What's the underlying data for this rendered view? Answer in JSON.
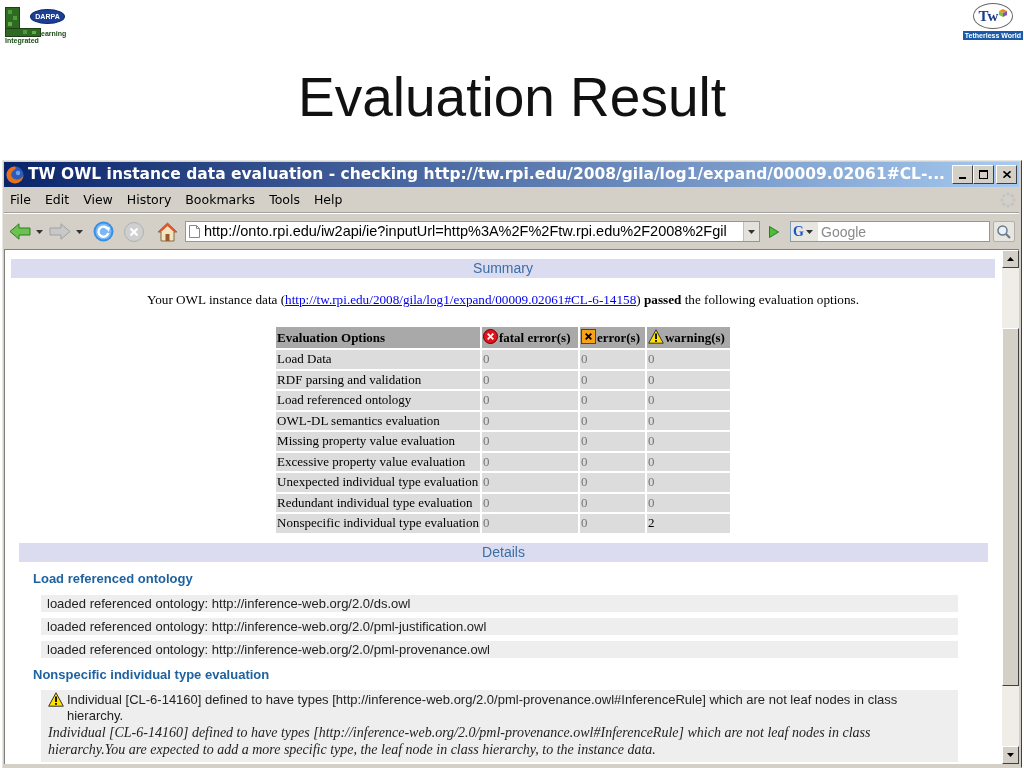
{
  "slide": {
    "left_logo": {
      "badge": "DARPA",
      "line_1": "earning",
      "line_2": "Integrated"
    },
    "right_logo": {
      "mark": "Tw",
      "caption": "Tetherless World"
    },
    "title": "Evaluation Result"
  },
  "window": {
    "title": "TW OWL instance data evaluation - checking http://tw.rpi.edu/2008/gila/log1/expand/00009.02061#CL-..."
  },
  "menu": [
    "File",
    "Edit",
    "View",
    "History",
    "Bookmarks",
    "Tools",
    "Help"
  ],
  "toolbar": {
    "address": "http://onto.rpi.edu/iw2api/ie?inputUrl=http%3A%2F%2Ftw.rpi.edu%2F2008%2Fgil",
    "search_engine": "G",
    "search": {
      "placeholder": "Google"
    }
  },
  "summary": {
    "heading": "Summary",
    "sentence": {
      "before": "Your OWL instance data (",
      "link": "http://tw.rpi.edu/2008/gila/log1/expand/00009.02061#CL-6-14158",
      "after": ") **passed** the following evaluation options."
    },
    "table": {
      "columns": [
        {
          "label": "Evaluation Options",
          "kind": "plain"
        },
        {
          "label": "fatal error(s)",
          "kind": "fatal"
        },
        {
          "label": "error(s)",
          "kind": "error"
        },
        {
          "label": "warning(s)",
          "kind": "warning"
        }
      ],
      "rows": [
        {
          "option": "Load Data",
          "counts": [
            {
              "value": "0",
              "faded": true
            },
            {
              "value": "0",
              "faded": true
            },
            {
              "value": "0",
              "faded": true
            }
          ]
        },
        {
          "option": "RDF parsing and validation",
          "counts": [
            {
              "value": "0",
              "faded": true
            },
            {
              "value": "0",
              "faded": true
            },
            {
              "value": "0",
              "faded": true
            }
          ]
        },
        {
          "option": "Load referenced ontology",
          "counts": [
            {
              "value": "0",
              "faded": true
            },
            {
              "value": "0",
              "faded": true
            },
            {
              "value": "0",
              "faded": true
            }
          ]
        },
        {
          "option": "OWL-DL semantics evaluation",
          "counts": [
            {
              "value": "0",
              "faded": true
            },
            {
              "value": "0",
              "faded": true
            },
            {
              "value": "0",
              "faded": true
            }
          ]
        },
        {
          "option": "Missing property value evaluation",
          "counts": [
            {
              "value": "0",
              "faded": true
            },
            {
              "value": "0",
              "faded": true
            },
            {
              "value": "0",
              "faded": true
            }
          ]
        },
        {
          "option": "Excessive property value evaluation",
          "counts": [
            {
              "value": "0",
              "faded": true
            },
            {
              "value": "0",
              "faded": true
            },
            {
              "value": "0",
              "faded": true
            }
          ]
        },
        {
          "option": "Unexpected individual type evaluation",
          "counts": [
            {
              "value": "0",
              "faded": true
            },
            {
              "value": "0",
              "faded": true
            },
            {
              "value": "0",
              "faded": true
            }
          ]
        },
        {
          "option": "Redundant individual type evaluation",
          "counts": [
            {
              "value": "0",
              "faded": true
            },
            {
              "value": "0",
              "faded": true
            },
            {
              "value": "0",
              "faded": true
            }
          ]
        },
        {
          "option": "Nonspecific individual type evaluation",
          "counts": [
            {
              "value": "0",
              "faded": true
            },
            {
              "value": "0",
              "faded": true
            },
            {
              "value": "2",
              "faded": false
            }
          ]
        }
      ]
    }
  },
  "details": {
    "heading": "Details",
    "sections": [
      {
        "title": "Load referenced ontology",
        "kind": "list",
        "items": [
          "loaded referenced ontology: http://inference-web.org/2.0/ds.owl",
          "loaded referenced ontology: http://inference-web.org/2.0/pml-justification.owl",
          "loaded referenced ontology: http://inference-web.org/2.0/pml-provenance.owl"
        ]
      },
      {
        "title": "Nonspecific individual type evaluation",
        "kind": "warning",
        "message": "Individual [CL-6-14160] defined to have types [http://inference-web.org/2.0/pml-provenance.owl#InferenceRule] which are not leaf nodes in class hierarchy.",
        "explanation": "Individual [CL-6-14160] defined to have types [http://inference-web.org/2.0/pml-provenance.owl#InferenceRule] which are not leaf nodes in class hierarchy.You are expected to add a more specific type, the leaf node in class hierarchy, to the instance data."
      }
    ]
  }
}
